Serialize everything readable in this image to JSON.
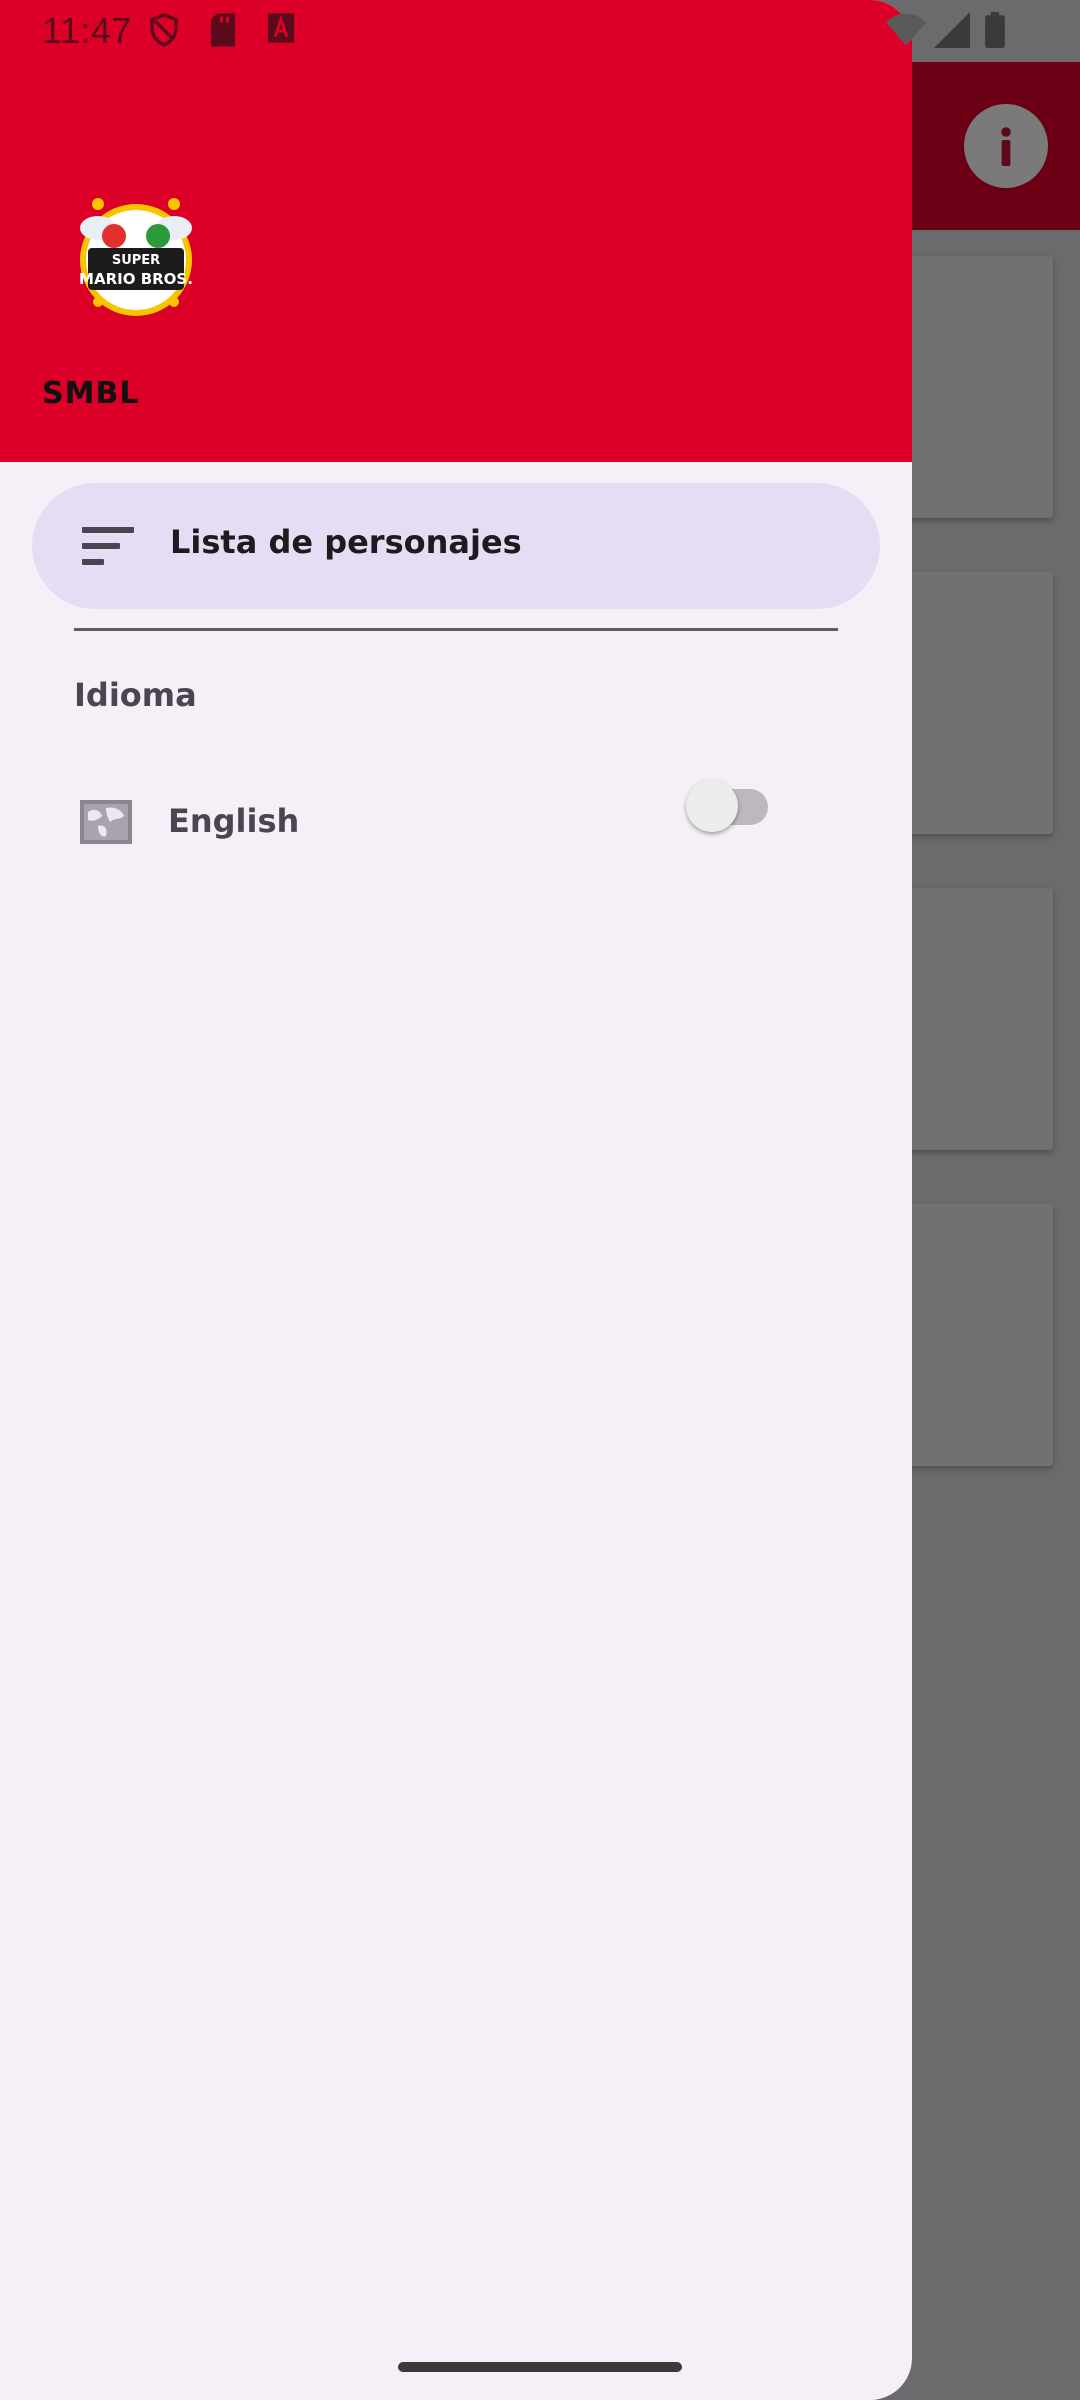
{
  "status_bar": {
    "time": "11:47",
    "icons_left": [
      "shield-icon",
      "sd-card-icon",
      "a-icon"
    ],
    "icons_right": [
      "wifi-icon",
      "signal-icon",
      "battery-icon"
    ]
  },
  "background_app": {
    "action_icon": "info-icon"
  },
  "drawer": {
    "header": {
      "logo_text": "SUPER MARIO BROS.",
      "title": "SMBL",
      "background_color": "#dc0028"
    },
    "nav_items": [
      {
        "icon": "sort-list-icon",
        "label": "Lista de personajes",
        "selected": true
      }
    ],
    "section_title": "Idioma",
    "language_toggle": {
      "icon": "globe-map-icon",
      "label": "English",
      "enabled": false
    }
  },
  "colors": {
    "accent": "#dc0028",
    "selected_item_bg": "#e6ddf4",
    "drawer_bg": "#f5f0f7"
  }
}
